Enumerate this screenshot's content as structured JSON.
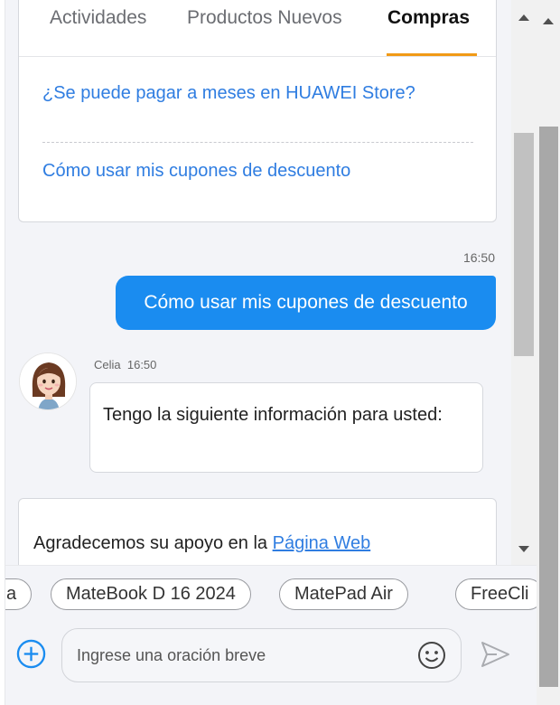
{
  "tabs": [
    {
      "label": "Actividades",
      "active": false
    },
    {
      "label": "Productos Nuevos",
      "active": false
    },
    {
      "label": "Compras",
      "active": true
    }
  ],
  "faq_links": [
    "¿Se puede pagar a meses en HUAWEI Store?",
    "Cómo usar mis cupones de descuento"
  ],
  "messages": {
    "user": {
      "time": "16:50",
      "text": "Cómo usar mis cupones de descuento"
    },
    "agent": {
      "name": "Celia",
      "time": "16:50",
      "text": "Tengo la siguiente información para usted:"
    },
    "info": {
      "text": "Agradecemos su apoyo en la ",
      "link": "Página Web"
    }
  },
  "chips": [
    "a",
    "MateBook D 16 2024",
    "MatePad Air",
    "FreeCli"
  ],
  "input": {
    "placeholder": "Ingrese una oración breve",
    "value": ""
  },
  "icons": {
    "add": "plus-circle-icon",
    "emoji": "smiley-icon",
    "send": "send-icon"
  },
  "colors": {
    "accent": "#1a8cf0",
    "link": "#2f7de1",
    "tab_underline": "#f19a16"
  }
}
